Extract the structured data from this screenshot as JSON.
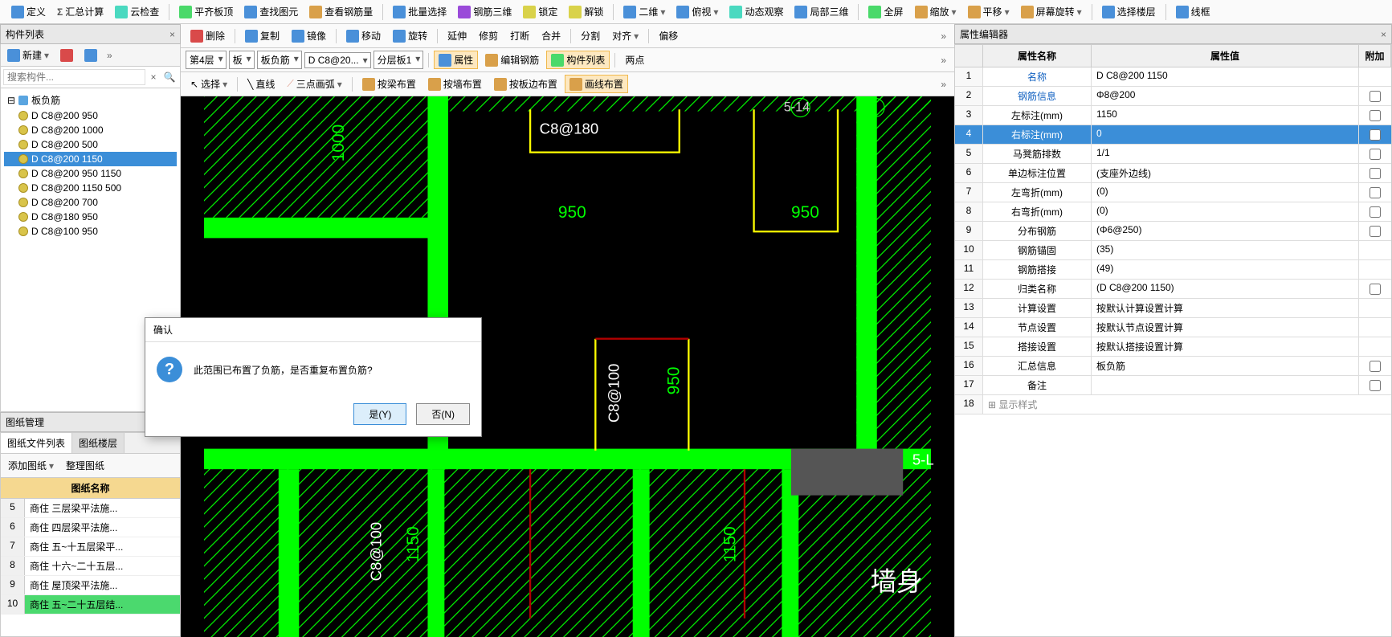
{
  "toolbar_main": {
    "define": "定义",
    "sum": "汇总计算",
    "cloud": "云检查",
    "flat": "平齐板顶",
    "find": "查找图元",
    "rebar": "查看钢筋量",
    "batch": "批量选择",
    "rebar3d": "钢筋三维",
    "lock": "锁定",
    "unlock": "解锁",
    "twod": "二维",
    "top": "俯视",
    "dyn": "动态观察",
    "loc3d": "局部三维",
    "full": "全屏",
    "zoom": "缩放",
    "pan": "平移",
    "screen": "屏幕旋转",
    "floor": "选择楼层",
    "wire": "线框"
  },
  "left": {
    "panel_title": "构件列表",
    "new": "新建",
    "search_placeholder": "搜索构件...",
    "root": "板负筋",
    "items": [
      "D C8@200 950",
      "D C8@200 1000",
      "D C8@200 500",
      "D C8@200 1150",
      "D C8@200 950 1150",
      "D C8@200 1150 500",
      "D C8@200 700",
      "D C8@180 950",
      "D C8@100 950"
    ],
    "selected_index": 3
  },
  "drawings": {
    "panel_title": "图纸管理",
    "tab1": "图纸文件列表",
    "tab2": "图纸楼层",
    "add": "添加图纸",
    "arrange": "整理图纸",
    "header": "图纸名称",
    "rows": [
      {
        "n": "5",
        "name": "商住 三层梁平法施..."
      },
      {
        "n": "6",
        "name": "商住 四层梁平法施..."
      },
      {
        "n": "7",
        "name": "商住 五~十五层梁平..."
      },
      {
        "n": "8",
        "name": "商住 十六~二十五层..."
      },
      {
        "n": "9",
        "name": "商住 屋顶梁平法施..."
      },
      {
        "n": "10",
        "name": "商住 五~二十五层结..."
      }
    ],
    "selected_index": 5
  },
  "center_tb": {
    "del": "删除",
    "copy": "复制",
    "mirror": "镜像",
    "move": "移动",
    "rotate": "旋转",
    "extend": "延伸",
    "trim": "修剪",
    "break": "打断",
    "merge": "合并",
    "split": "分割",
    "align": "对齐",
    "offset": "偏移",
    "floor": "第4层",
    "type": "板",
    "subtype": "板负筋",
    "spec": "D C8@20...",
    "layer": "分层板1",
    "attr": "属性",
    "edit": "编辑钢筋",
    "list": "构件列表",
    "pts": "两点",
    "select": "选择",
    "line": "直线",
    "arc": "三点画弧",
    "beam": "按梁布置",
    "wall": "按墙布置",
    "edge": "按板边布置",
    "draw": "画线布置"
  },
  "canvas": {
    "dim1000": "1000",
    "dim950a": "950",
    "dim950b": "950",
    "dim950c": "950",
    "dim1150": "1150",
    "c8180": "C8@180",
    "c8100a": "C8@100",
    "c8100b": "C8@100",
    "axis514": "5-14",
    "axis5L": "5-L",
    "wall": "墙身"
  },
  "props": {
    "title": "属性编辑器",
    "h_name": "属性名称",
    "h_val": "属性值",
    "h_add": "附加",
    "expand": "显示样式",
    "rows": [
      {
        "n": "1",
        "name": "名称",
        "val": "D C8@200 1150",
        "link": true,
        "cb": false
      },
      {
        "n": "2",
        "name": "钢筋信息",
        "val": "Φ8@200",
        "link": true,
        "cb": true
      },
      {
        "n": "3",
        "name": "左标注(mm)",
        "val": "1150",
        "link": false,
        "cb": true
      },
      {
        "n": "4",
        "name": "右标注(mm)",
        "val": "0",
        "link": false,
        "cb": true
      },
      {
        "n": "5",
        "name": "马凳筋排数",
        "val": "1/1",
        "link": false,
        "cb": true
      },
      {
        "n": "6",
        "name": "单边标注位置",
        "val": "(支座外边线)",
        "link": false,
        "cb": true
      },
      {
        "n": "7",
        "name": "左弯折(mm)",
        "val": "(0)",
        "link": false,
        "cb": true
      },
      {
        "n": "8",
        "name": "右弯折(mm)",
        "val": "(0)",
        "link": false,
        "cb": true
      },
      {
        "n": "9",
        "name": "分布钢筋",
        "val": "(Φ6@250)",
        "link": false,
        "cb": true
      },
      {
        "n": "10",
        "name": "钢筋锚固",
        "val": "(35)",
        "link": false,
        "cb": false
      },
      {
        "n": "11",
        "name": "钢筋搭接",
        "val": "(49)",
        "link": false,
        "cb": false
      },
      {
        "n": "12",
        "name": "归类名称",
        "val": "(D C8@200 1150)",
        "link": false,
        "cb": true
      },
      {
        "n": "13",
        "name": "计算设置",
        "val": "按默认计算设置计算",
        "link": false,
        "cb": false
      },
      {
        "n": "14",
        "name": "节点设置",
        "val": "按默认节点设置计算",
        "link": false,
        "cb": false
      },
      {
        "n": "15",
        "name": "搭接设置",
        "val": "按默认搭接设置计算",
        "link": false,
        "cb": false
      },
      {
        "n": "16",
        "name": "汇总信息",
        "val": "板负筋",
        "link": false,
        "cb": true
      },
      {
        "n": "17",
        "name": "备注",
        "val": "",
        "link": false,
        "cb": true
      }
    ],
    "selected_index": 3,
    "expand_n": "18"
  },
  "dialog": {
    "title": "确认",
    "message": "此范围已布置了负筋，是否重复布置负筋?",
    "yes": "是(Y)",
    "no": "否(N)"
  }
}
